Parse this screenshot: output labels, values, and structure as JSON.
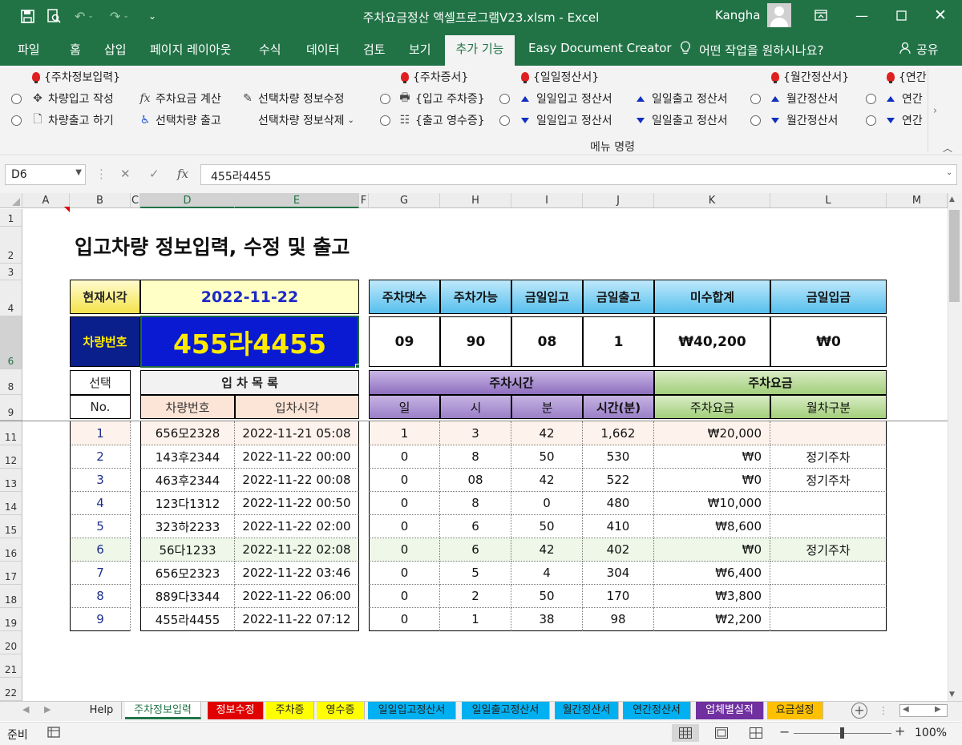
{
  "window": {
    "title": "주차요금정산 액셀프로그램V23.xlsm  -  Excel",
    "user": "Kangha"
  },
  "ribbon_tabs": [
    "파일",
    "홈",
    "삽입",
    "페이지 레이아웃",
    "수식",
    "데이터",
    "검토",
    "보기",
    "추가 기능",
    "Easy Document Creator"
  ],
  "tell_me": "어떤 작업을 원하시나요?",
  "share": "공유",
  "ribbon": {
    "grp1": "{주차정보입력}",
    "car_in": "차량입고 작성",
    "car_out": "차량출고 하기",
    "calc_fee": "주차요금 계산",
    "sel_out": "선택차량 출고",
    "sel_edit": "선택차량 정보수정",
    "sel_del": "선택차량 정보삭제",
    "grp2": "{주차증서}",
    "in_ticket": "{입고 주차증}",
    "out_receipt": "{출고 영수증}",
    "grp3": "{일일정산서}",
    "daily_in_up": "일일입고 정산서",
    "daily_in_dn": "일일입고 정산서",
    "daily_out_up": "일일출고 정산서",
    "daily_out_dn": "일일출고 정산서",
    "grp4": "{월간정산서}",
    "monthly_up": "월간정산서",
    "monthly_dn": "월간정산서",
    "grp5": "{연간",
    "yearly_up": "연간",
    "yearly_dn": "연간",
    "group_label": "메뉴 명령"
  },
  "formula_bar": {
    "name_box": "D6",
    "formula": "455라4455"
  },
  "columns": [
    "A",
    "B",
    "C",
    "D",
    "E",
    "F",
    "G",
    "H",
    "I",
    "J",
    "K",
    "L",
    "M"
  ],
  "rows": [
    "1",
    "2",
    "3",
    "4",
    "6",
    "8",
    "9",
    "11",
    "12",
    "13",
    "14",
    "15",
    "16",
    "17",
    "18",
    "19",
    "20",
    "21",
    "22"
  ],
  "sheet": {
    "title": "입고차량 정보입력, 수정 및 출고",
    "now_label": "현재시각",
    "now_value": "2022-11-22",
    "plate_label": "차량번호",
    "plate_value": "455라4455",
    "summary_headers": [
      "주차댓수",
      "주차가능",
      "금일입고",
      "금일출고",
      "미수합계",
      "금일입금"
    ],
    "summary_values": [
      "09",
      "90",
      "08",
      "1",
      "₩40,200",
      "₩0"
    ],
    "select_label": "선택",
    "no_label": "No.",
    "list_title": "입 차 목 록",
    "plate_col": "차량번호",
    "entry_col": "입차시각",
    "park_time": "주차시간",
    "park_fee": "주차요금",
    "time_cols": [
      "일",
      "시",
      "분",
      "시간(분)"
    ],
    "fee_col": "주차요금",
    "monthly_col": "월차구분",
    "rows": [
      [
        "1",
        "656모2328",
        "2022-11-21 05:08",
        "1",
        "3",
        "42",
        "1,662",
        "₩20,000",
        ""
      ],
      [
        "2",
        "143후2344",
        "2022-11-22 00:00",
        "0",
        "8",
        "50",
        "530",
        "₩0",
        "정기주차"
      ],
      [
        "3",
        "463후2344",
        "2022-11-22 00:08",
        "0",
        "08",
        "42",
        "522",
        "₩0",
        "정기주차"
      ],
      [
        "4",
        "123다1312",
        "2022-11-22 00:50",
        "0",
        "8",
        "0",
        "480",
        "₩10,000",
        ""
      ],
      [
        "5",
        "323하2233",
        "2022-11-22 02:00",
        "0",
        "6",
        "50",
        "410",
        "₩8,600",
        ""
      ],
      [
        "6",
        "56다1233",
        "2022-11-22 02:08",
        "0",
        "6",
        "42",
        "402",
        "₩0",
        "정기주차"
      ],
      [
        "7",
        "656모2323",
        "2022-11-22 03:46",
        "0",
        "5",
        "4",
        "304",
        "₩6,400",
        ""
      ],
      [
        "8",
        "889다3344",
        "2022-11-22 06:00",
        "0",
        "2",
        "50",
        "170",
        "₩3,800",
        ""
      ],
      [
        "9",
        "455라4455",
        "2022-11-22 07:12",
        "0",
        "1",
        "38",
        "98",
        "₩2,200",
        ""
      ]
    ]
  },
  "sheet_tabs": [
    {
      "label": "Help",
      "color": "#f0f0f0",
      "fg": "#222"
    },
    {
      "label": "주차정보입력",
      "color": "#ffffff",
      "fg": "#217346"
    },
    {
      "label": "정보수정",
      "color": "#e00000",
      "fg": "#ffffff"
    },
    {
      "label": "주차증",
      "color": "#ffff00",
      "fg": "#222"
    },
    {
      "label": "영수증",
      "color": "#ffff00",
      "fg": "#222"
    },
    {
      "label": "일일입고정산서",
      "color": "#00b0f0",
      "fg": "#222"
    },
    {
      "label": "일일출고정산서",
      "color": "#00b0f0",
      "fg": "#222"
    },
    {
      "label": "월간정산서",
      "color": "#00b0f0",
      "fg": "#222"
    },
    {
      "label": "연간정산서",
      "color": "#00b0f0",
      "fg": "#222"
    },
    {
      "label": "업체별실적",
      "color": "#7030a0",
      "fg": "#ffffff"
    },
    {
      "label": "요금설정",
      "color": "#ffc000",
      "fg": "#222"
    }
  ],
  "status": {
    "ready": "준비",
    "zoom": "100%"
  }
}
